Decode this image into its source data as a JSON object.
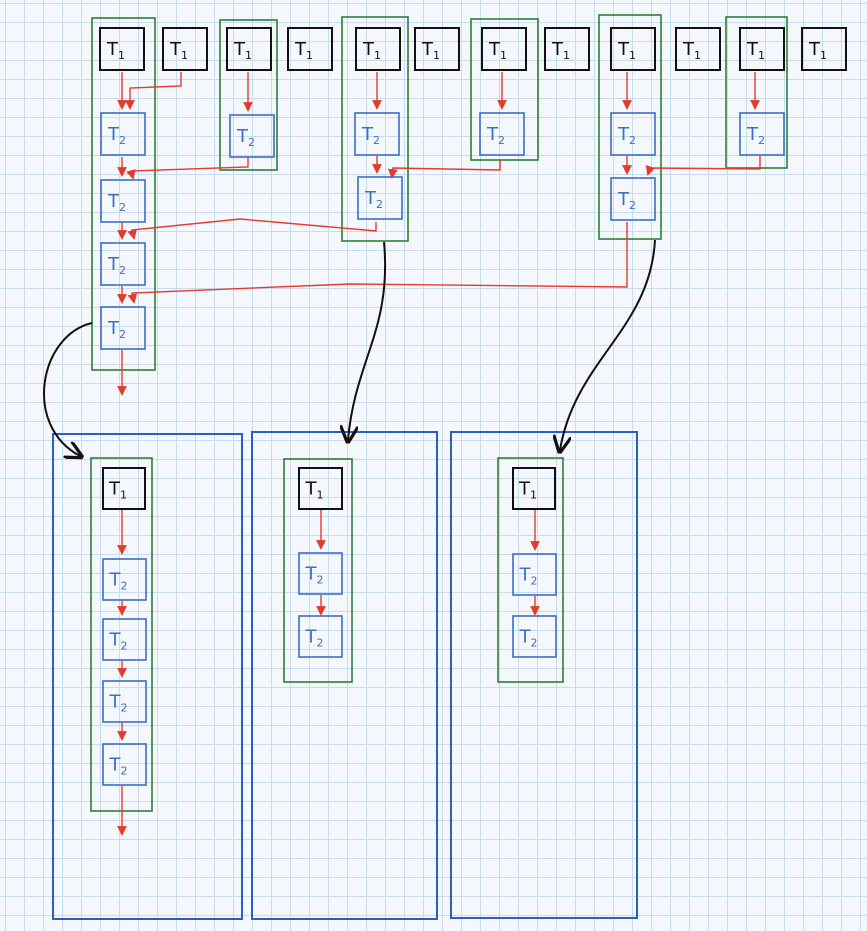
{
  "colors": {
    "grid": "#c9dcee",
    "t1": "#111111",
    "t2": "#3b6fc4",
    "group": "#2e7d3a",
    "container": "#2b5fc0",
    "dependency_arrow": "#e53a2e",
    "move_arrow": "#111111"
  },
  "labels": {
    "t1": "T1",
    "t2": "T2"
  },
  "top_row": {
    "t1_count": 12,
    "columns": [
      {
        "col": 1,
        "t2": 4,
        "absorbs": [
          2,
          3
        ]
      },
      {
        "col": 3,
        "t2": 1
      },
      {
        "col": 5,
        "t2": 2,
        "absorbs": [
          7
        ]
      },
      {
        "col": 7,
        "t2": 1
      },
      {
        "col": 9,
        "t2": 2,
        "absorbs": [
          11
        ]
      },
      {
        "col": 11,
        "t2": 1
      }
    ]
  },
  "bottom_row": {
    "containers": [
      {
        "t1": 1,
        "t2": 4
      },
      {
        "t1": 1,
        "t2": 2
      },
      {
        "t1": 1,
        "t2": 2
      }
    ]
  }
}
